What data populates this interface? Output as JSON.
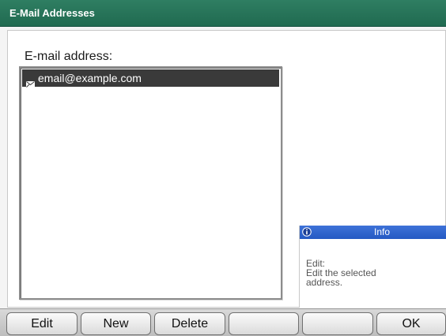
{
  "window": {
    "title": "E-Mail Addresses"
  },
  "list": {
    "label": "E-mail address:",
    "items": [
      {
        "text": "email@example.com",
        "icon": "envelope-icon",
        "selected": true
      }
    ]
  },
  "info": {
    "title": "Info",
    "icon": "info-icon",
    "lines": [
      "Edit:",
      "Edit the selected",
      "address."
    ]
  },
  "buttons": {
    "edit": "Edit",
    "new": "New",
    "delete": "Delete",
    "blank1": "",
    "blank2": "",
    "ok": "OK"
  },
  "colors": {
    "title_bar": "#206a50",
    "info_header": "#2f66d0",
    "selection": "#3a3a3a"
  }
}
